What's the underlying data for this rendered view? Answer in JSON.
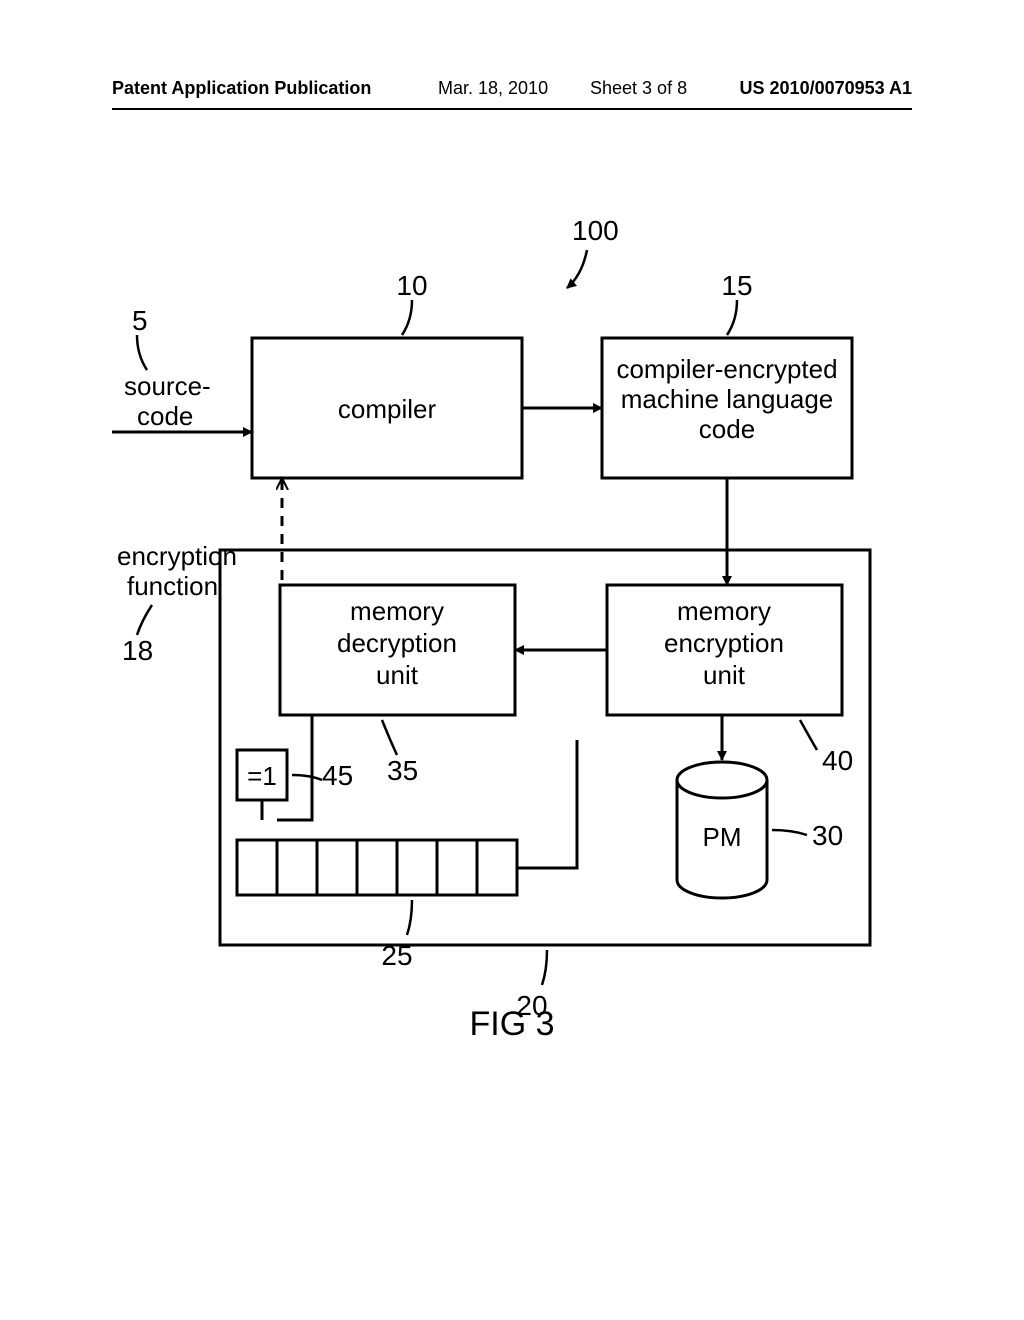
{
  "header": {
    "pub_type": "Patent Application Publication",
    "pub_date": "Mar. 18, 2010",
    "sheet": "Sheet 3 of 8",
    "pub_id": "US 2010/0070953 A1"
  },
  "diagram": {
    "refs": {
      "r5": "5",
      "r10": "10",
      "r15": "15",
      "r18": "18",
      "r20": "20",
      "r25": "25",
      "r30": "30",
      "r35": "35",
      "r40": "40",
      "r45": "45",
      "r100": "100"
    },
    "labels": {
      "sourcecode1": "source-",
      "sourcecode2": "code",
      "compiler": "compiler",
      "encrypted1": "compiler-encrypted",
      "encrypted2": "machine language",
      "encrypted3": "code",
      "encfunc1": "encryption",
      "encfunc2": "function",
      "memdec1": "memory",
      "memdec2": "decryption",
      "memdec3": "unit",
      "memenc1": "memory",
      "memenc2": "encryption",
      "memenc3": "unit",
      "pm": "PM",
      "eq1": "=1"
    },
    "figcaption": "FIG 3"
  }
}
